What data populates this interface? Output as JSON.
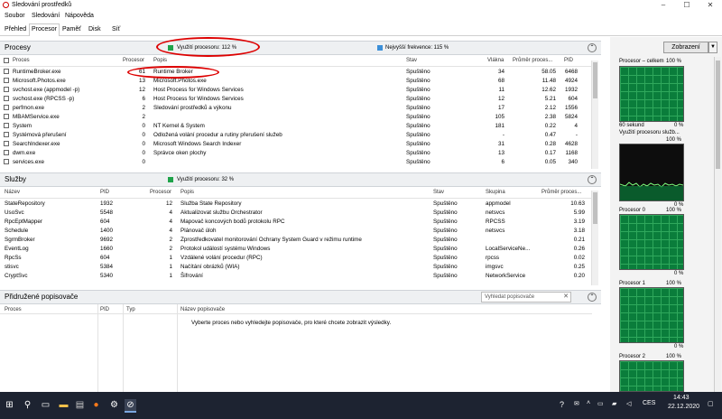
{
  "window": {
    "title": "Sledování prostředků"
  },
  "menu": [
    "Soubor",
    "Sledování",
    "Nápověda"
  ],
  "tabs": [
    "Přehled",
    "Procesor",
    "Paměť",
    "Disk",
    "Síť"
  ],
  "processes": {
    "title": "Procesy",
    "cpu_usage": "Využití procesoru: 112 %",
    "max_freq": "Nejvyšší frekvence: 115 %",
    "columns": [
      "Proces",
      "Procesor",
      "Popis",
      "Stav",
      "Vlákna",
      "Průměr proces...",
      "PID"
    ],
    "rows": [
      [
        "RuntimeBroker.exe",
        "61",
        "Runtime Broker",
        "Spuštěno",
        "34",
        "58.05",
        "6468"
      ],
      [
        "Microsoft.Photos.exe",
        "13",
        "Microsoft.Photos.exe",
        "Spuštěno",
        "68",
        "11.48",
        "4924"
      ],
      [
        "svchost.exe (appmodel -p)",
        "12",
        "Host Process for Windows Services",
        "Spuštěno",
        "11",
        "12.62",
        "1932"
      ],
      [
        "svchost.exe (RPCSS -p)",
        "6",
        "Host Process for Windows Services",
        "Spuštěno",
        "12",
        "5.21",
        "604"
      ],
      [
        "perfmon.exe",
        "2",
        "Sledování prostředků a výkonu",
        "Spuštěno",
        "17",
        "2.12",
        "1556"
      ],
      [
        "MBAMService.exe",
        "2",
        "",
        "Spuštěno",
        "105",
        "2.38",
        "5824"
      ],
      [
        "System",
        "0",
        "NT Kernel & System",
        "Spuštěno",
        "181",
        "0.22",
        "4"
      ],
      [
        "Systémová přerušení",
        "0",
        "Odložená volání procedur a rutiny přerušení služeb",
        "Spuštěno",
        "-",
        "0.47",
        "-"
      ],
      [
        "SearchIndexer.exe",
        "0",
        "Microsoft Windows Search Indexer",
        "Spuštěno",
        "31",
        "0.28",
        "4628"
      ],
      [
        "dwm.exe",
        "0",
        "Správce oken plochy",
        "Spuštěno",
        "13",
        "0.17",
        "1168"
      ],
      [
        "services.exe",
        "0",
        "",
        "Spuštěno",
        "6",
        "0.05",
        "340"
      ]
    ]
  },
  "services": {
    "title": "Služby",
    "cpu_usage": "Využití procesoru: 32 %",
    "columns": [
      "Název",
      "PID",
      "Procesor",
      "Popis",
      "Stav",
      "Skupina",
      "Průměr proces..."
    ],
    "rows": [
      [
        "StateRepository",
        "1932",
        "12",
        "Služba State Repository",
        "Spuštěno",
        "appmodel",
        "10.63"
      ],
      [
        "UsoSvc",
        "5548",
        "4",
        "Aktualizovat službu Orchestrator",
        "Spuštěno",
        "netsvcs",
        "5.99"
      ],
      [
        "RpcEptMapper",
        "604",
        "4",
        "Mapovač koncových bodů protokolu RPC",
        "Spuštěno",
        "RPCSS",
        "3.19"
      ],
      [
        "Schedule",
        "1400",
        "4",
        "Plánovač úloh",
        "Spuštěno",
        "netsvcs",
        "3.18"
      ],
      [
        "SgrmBroker",
        "9692",
        "2",
        "Zprostředkovatel monitorování Ochrany System Guard v režimu runtime",
        "Spuštěno",
        "",
        "0.21"
      ],
      [
        "EventLog",
        "1660",
        "2",
        "Protokol událostí systému Windows",
        "Spuštěno",
        "LocalServiceNe...",
        "0.26"
      ],
      [
        "RpcSs",
        "604",
        "1",
        "Vzdálené volání procedur (RPC)",
        "Spuštěno",
        "rpcss",
        "0.02"
      ],
      [
        "stisvc",
        "5384",
        "1",
        "Načítání obrázků (WIA)",
        "Spuštěno",
        "imgsvc",
        "0.25"
      ],
      [
        "CryptSvc",
        "5340",
        "1",
        "Šifrování",
        "Spuštěno",
        "NetworkService",
        "0.20"
      ]
    ]
  },
  "handles": {
    "title": "Přidružené popisovače",
    "search_placeholder": "Vyhledat popisovače",
    "columns": [
      "Proces",
      "PID",
      "Typ",
      "Název popisovače"
    ],
    "empty_message": "Vyberte proces nebo vyhledejte popisovače, pro které chcete zobrazit výsledky."
  },
  "graphs": {
    "view_button": "Zobrazení",
    "total_title": "Procesor – celkem",
    "max_label": "100 %",
    "min_label": "0 %",
    "seconds_label": "60 sekund",
    "service_title": "Využití procesoru služb...",
    "cores": [
      "Procesor 0",
      "Procesor 1",
      "Procesor 2"
    ]
  },
  "colors": {
    "green": "#1fa34a",
    "blue": "#3c8fd8",
    "highlight": "#d00000",
    "graph_bg": "#0a7d3b",
    "graph_line": "#7dff7d"
  },
  "taskbar": {
    "lang": "CES",
    "time": "14:43",
    "date": "22.12.2020"
  }
}
